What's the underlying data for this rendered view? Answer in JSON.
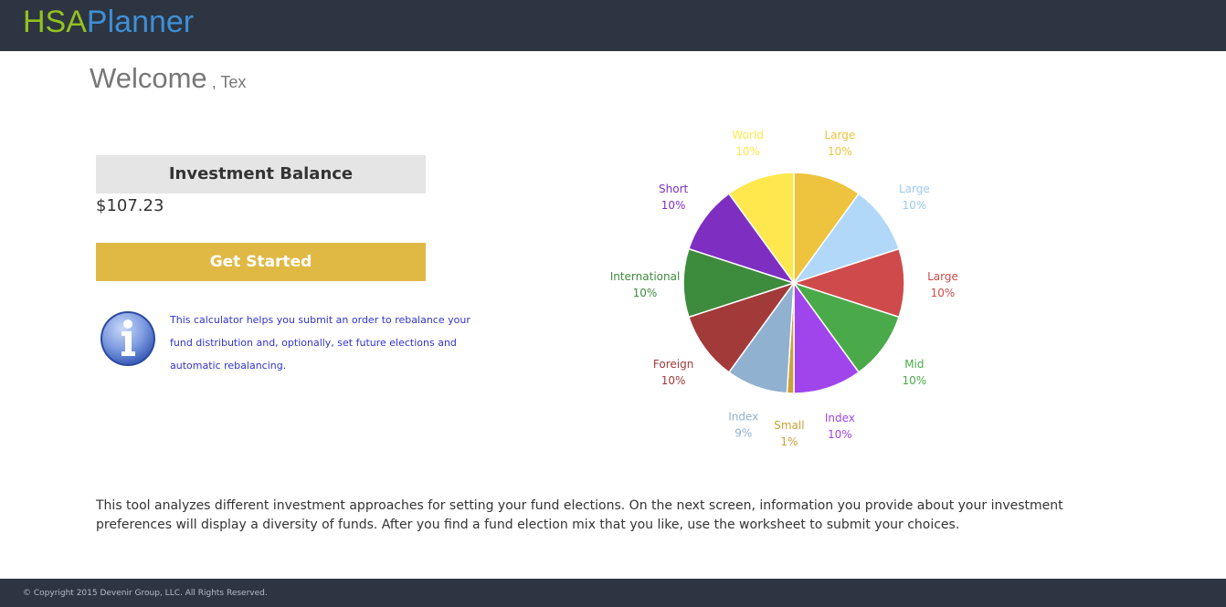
{
  "header": {
    "logo_part1": "HSA",
    "logo_part2": "Planner"
  },
  "welcome": {
    "title": "Welcome",
    "name": ", Tex"
  },
  "balance": {
    "heading": "Investment Balance",
    "value": "$107.23"
  },
  "get_started_label": "Get Started",
  "info": {
    "icon": "info-icon",
    "text": "This calculator helps you submit an order to rebalance your fund distribution and, optionally, set future elections and automatic rebalancing."
  },
  "chart_data": {
    "type": "pie",
    "slices": [
      {
        "label": "Large",
        "value": 10,
        "pct": "10%",
        "color": "#eec33d"
      },
      {
        "label": "Large",
        "value": 10,
        "pct": "10%",
        "color": "#b1d8f9"
      },
      {
        "label": "Large",
        "value": 10,
        "pct": "10%",
        "color": "#cf4a4a"
      },
      {
        "label": "Mid",
        "value": 10,
        "pct": "10%",
        "color": "#4aaa4a"
      },
      {
        "label": "Index",
        "value": 10,
        "pct": "10%",
        "color": "#a044ec"
      },
      {
        "label": "Small",
        "value": 1,
        "pct": "1%",
        "color": "#c9a23a"
      },
      {
        "label": "Index",
        "value": 9,
        "pct": "9%",
        "color": "#90b1cf"
      },
      {
        "label": "Foreign",
        "value": 10,
        "pct": "10%",
        "color": "#a33a3a"
      },
      {
        "label": "International",
        "value": 10,
        "pct": "10%",
        "color": "#3d8c3d"
      },
      {
        "label": "Short",
        "value": 10,
        "pct": "10%",
        "color": "#7e2fc2"
      },
      {
        "label": "World",
        "value": 10,
        "pct": "10%",
        "color": "#ffe84d"
      }
    ]
  },
  "description": "This tool analyzes different investment approaches for setting your fund elections. On the next screen, information you provide about your investment preferences will display a diversity of funds. After you find a fund election mix that you like, use the worksheet to submit your choices.",
  "footer": {
    "copyright": "© Copyright 2015 Devenir Group, LLC. All Rights Reserved."
  }
}
